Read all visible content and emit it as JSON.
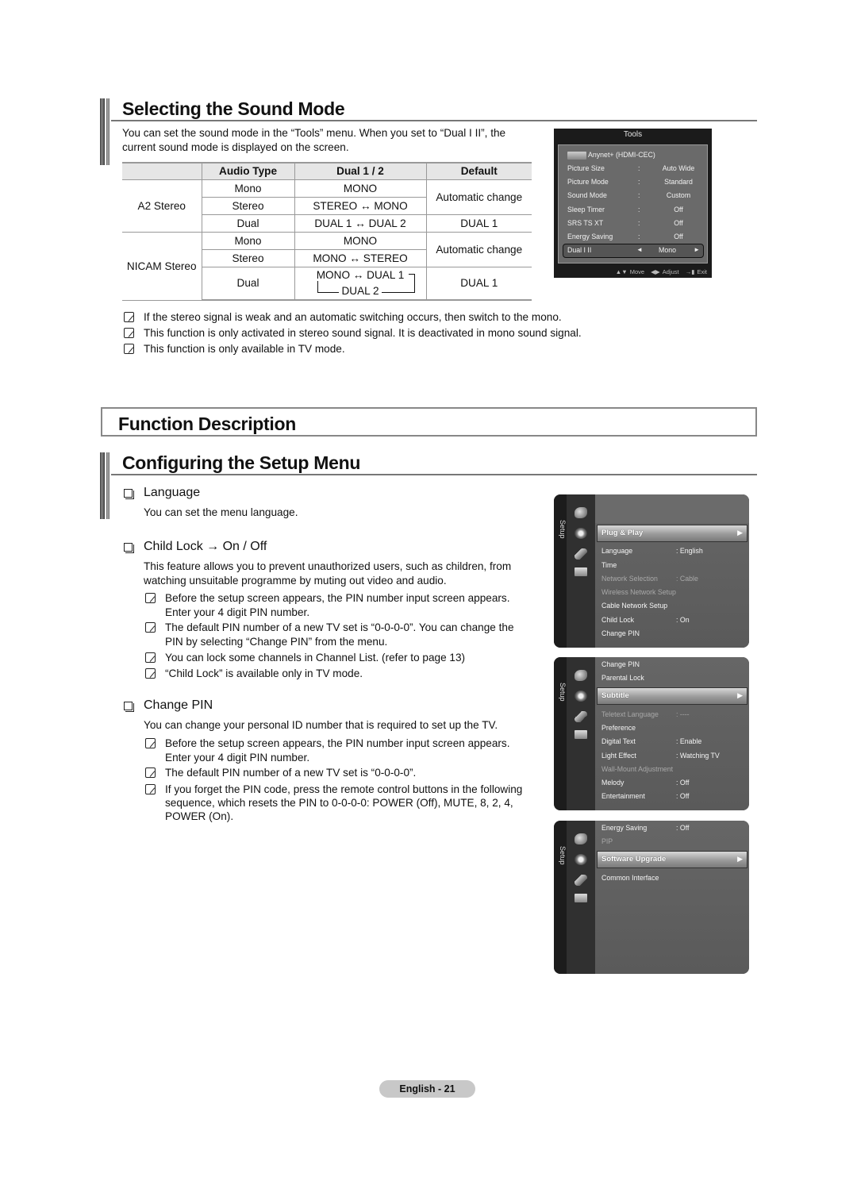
{
  "sound_mode": {
    "title": "Selecting the Sound Mode",
    "intro_line1": "You can set the sound mode in the “Tools” menu. When you set to “Dual I II”, the",
    "intro_line2": "current sound mode is displayed on the screen.",
    "table": {
      "headers": [
        "",
        "Audio Type",
        "Dual 1 / 2",
        "Default"
      ],
      "groups": [
        {
          "name": "A2 Stereo",
          "rows": [
            {
              "audio_type": "Mono",
              "dual": "MONO"
            },
            {
              "audio_type": "Stereo",
              "dual": "STEREO ↔ MONO"
            },
            {
              "audio_type": "Dual",
              "dual": "DUAL 1 ↔ DUAL 2"
            }
          ],
          "default_auto": "Automatic change",
          "default_dual": "DUAL 1"
        },
        {
          "name": "NICAM Stereo",
          "rows": [
            {
              "audio_type": "Mono",
              "dual": "MONO"
            },
            {
              "audio_type": "Stereo",
              "dual": "MONO ↔ STEREO"
            },
            {
              "audio_type": "Dual",
              "dual_line1": "MONO ↔ DUAL 1",
              "dual_line2": "DUAL 2"
            }
          ],
          "default_auto": "Automatic change",
          "default_dual": "DUAL 1"
        }
      ]
    },
    "notes": [
      "If the stereo signal is weak and an automatic switching occurs, then switch to the mono.",
      "This function is only activated in stereo sound signal. It is deactivated in mono sound signal.",
      "This function is only available in TV mode."
    ]
  },
  "tools_osd": {
    "title": "Tools",
    "anynet": "Anynet+ (HDMI-CEC)",
    "rows": [
      {
        "label": "Picture Size",
        "sep": ":",
        "value": "Auto Wide"
      },
      {
        "label": "Picture Mode",
        "sep": ":",
        "value": "Standard"
      },
      {
        "label": "Sound Mode",
        "sep": ":",
        "value": "Custom"
      },
      {
        "label": "Sleep Timer",
        "sep": ":",
        "value": "Off"
      },
      {
        "label": "SRS TS XT",
        "sep": ":",
        "value": "Off"
      },
      {
        "label": "Energy Saving",
        "sep": ":",
        "value": "Off"
      }
    ],
    "selected": {
      "label": "Dual I II",
      "left_arrow": "◄",
      "value": "Mono",
      "right_arrow": "►"
    },
    "footer": {
      "move": "Move",
      "adjust": "Adjust",
      "exit": "Exit"
    }
  },
  "function_description": {
    "title": "Function Description"
  },
  "setup_menu": {
    "title": "Configuring the Setup Menu",
    "language": {
      "title": "Language",
      "text": "You can set the menu language."
    },
    "child_lock": {
      "title": "Child Lock → On / Off",
      "text_line1": "This feature allows you to prevent unauthorized users, such as children, from",
      "text_line2": "watching unsuitable programme by muting out video and audio.",
      "notes": [
        {
          "l1": "Before the setup screen appears, the PIN number input screen appears.",
          "l2": "Enter your 4 digit PIN number."
        },
        {
          "l1": "The default PIN number of a new TV set is “0-0-0-0”. You can change the",
          "l2": "PIN by selecting “Change PIN” from the menu."
        },
        {
          "l1": "You can lock some channels in Channel List. (refer to page 13)"
        },
        {
          "l1": "“Child Lock” is available only in TV mode."
        }
      ]
    },
    "change_pin": {
      "title": "Change PIN",
      "text": "You can change your personal ID number that is required to set up the TV.",
      "notes": [
        {
          "l1": "Before the setup screen appears, the PIN number input screen appears.",
          "l2": "Enter your 4 digit PIN number."
        },
        {
          "l1": "The default PIN number of a new TV set is “0-0-0-0”."
        },
        {
          "l1": "If you forget the PIN code, press the remote control buttons in the following",
          "l2": "sequence, which resets the PIN to 0-0-0-0: POWER (Off), MUTE, 8, 2, 4,",
          "l3": "POWER (On)."
        }
      ]
    }
  },
  "setup_osd_1": {
    "side_label": "Setup",
    "selected": "Plug & Play",
    "items": [
      {
        "label": "Language",
        "value": ": English",
        "dim": false
      },
      {
        "label": "Time",
        "value": "",
        "dim": false
      },
      {
        "label": "Network Selection",
        "value": ": Cable",
        "dim": true
      },
      {
        "label": "Wireless Network Setup",
        "value": "",
        "dim": true
      },
      {
        "label": "Cable Network Setup",
        "value": "",
        "dim": false
      },
      {
        "label": "Child Lock",
        "value": ": On",
        "dim": false
      },
      {
        "label": "Change PIN",
        "value": "",
        "dim": false
      }
    ]
  },
  "setup_osd_2": {
    "side_label": "Setup",
    "above": [
      "Change PIN",
      "Parental Lock"
    ],
    "selected": "Subtitle",
    "items": [
      {
        "label": "Teletext Language",
        "value": ": ----",
        "dim": true
      },
      {
        "label": "Preference",
        "value": "",
        "dim": false
      },
      {
        "label": "Digital Text",
        "value": ": Enable",
        "dim": false
      },
      {
        "label": "Light Effect",
        "value": ": Watching TV",
        "dim": false
      },
      {
        "label": "Wall-Mount Adjustment",
        "value": "",
        "dim": true
      },
      {
        "label": "Melody",
        "value": ": Off",
        "dim": false
      },
      {
        "label": "Entertainment",
        "value": ": Off",
        "dim": false
      }
    ]
  },
  "setup_osd_3": {
    "side_label": "Setup",
    "above": [
      {
        "label": "Energy Saving",
        "value": ": Off",
        "dim": false
      },
      {
        "label": "PIP",
        "value": "",
        "dim": true
      }
    ],
    "selected": "Software Upgrade",
    "items": [
      {
        "label": "Common Interface",
        "value": "",
        "dim": false
      }
    ]
  },
  "footer": {
    "page_label": "English - 21"
  }
}
